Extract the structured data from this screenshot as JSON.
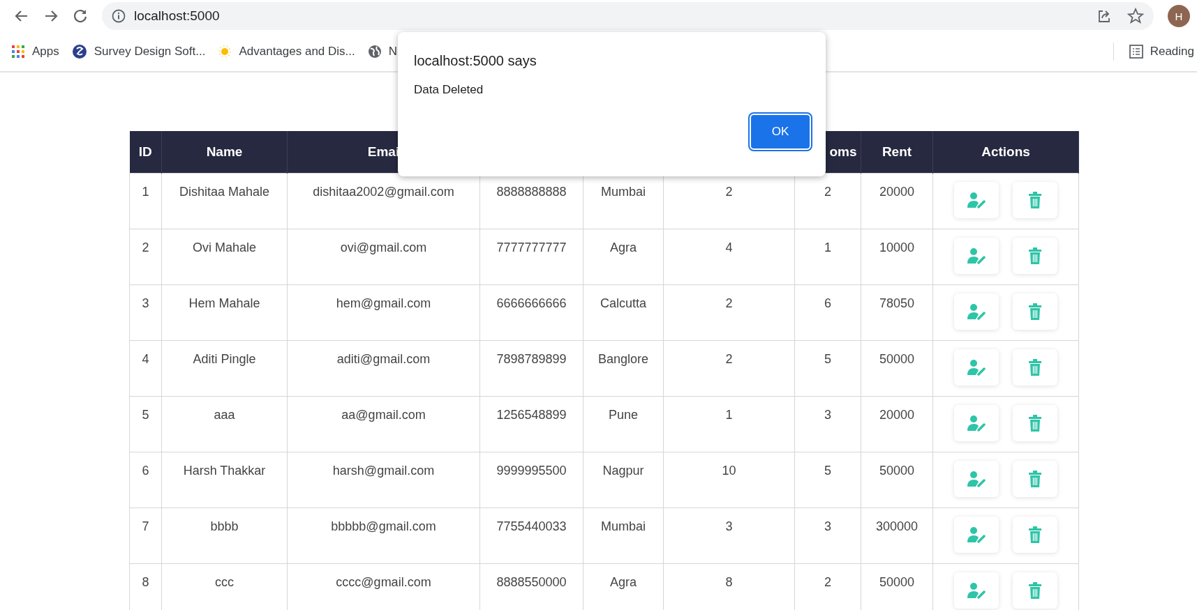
{
  "browser": {
    "address": "localhost:5000",
    "profile_initial": "H"
  },
  "bookmarks": [
    {
      "kind": "apps",
      "label": "Apps"
    },
    {
      "kind": "survey",
      "label": "Survey Design Soft..."
    },
    {
      "kind": "sun",
      "label": "Advantages and Dis..."
    },
    {
      "kind": "globe",
      "label": "N"
    }
  ],
  "reading_list": {
    "label": "Reading"
  },
  "dialog": {
    "title": "localhost:5000 says",
    "message": "Data Deleted",
    "button": "OK"
  },
  "table": {
    "columns": [
      "ID",
      "Name",
      "Emai",
      null,
      null,
      null,
      "oms",
      "Rent",
      "Actions"
    ],
    "rows": [
      [
        "1",
        "Dishitaa Mahale",
        "dishitaa2002@gmail.com",
        "8888888888",
        "Mumbai",
        "2",
        "2",
        "20000"
      ],
      [
        "2",
        "Ovi Mahale",
        "ovi@gmail.com",
        "7777777777",
        "Agra",
        "4",
        "1",
        "10000"
      ],
      [
        "3",
        "Hem Mahale",
        "hem@gmail.com",
        "6666666666",
        "Calcutta",
        "2",
        "6",
        "78050"
      ],
      [
        "4",
        "Aditi Pingle",
        "aditi@gmail.com",
        "7898789899",
        "Banglore",
        "2",
        "5",
        "50000"
      ],
      [
        "5",
        "aaa",
        "aa@gmail.com",
        "1256548899",
        "Pune",
        "1",
        "3",
        "20000"
      ],
      [
        "6",
        "Harsh Thakkar",
        "harsh@gmail.com",
        "9999995500",
        "Nagpur",
        "10",
        "5",
        "50000"
      ],
      [
        "7",
        "bbbb",
        "bbbbb@gmail.com",
        "7755440033",
        "Mumbai",
        "3",
        "3",
        "300000"
      ],
      [
        "8",
        "ccc",
        "cccc@gmail.com",
        "8888550000",
        "Agra",
        "8",
        "2",
        "50000"
      ]
    ]
  }
}
